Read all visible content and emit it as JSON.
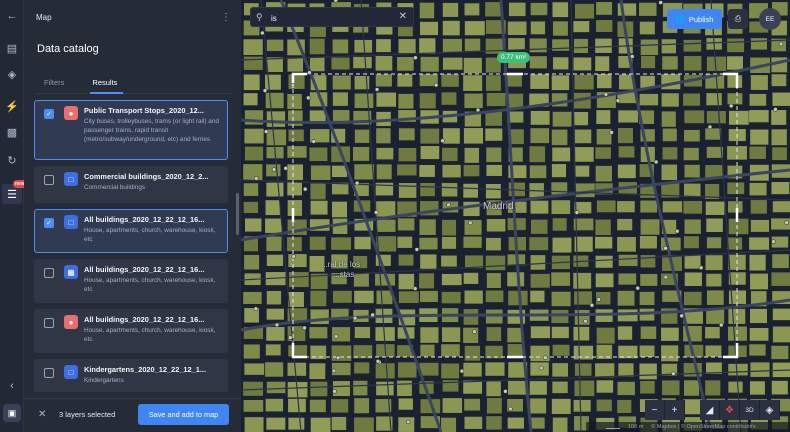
{
  "app": {
    "panel_label": "Map",
    "catalog_title": "Data catalog"
  },
  "tabs": [
    {
      "label": "Filters",
      "active": false
    },
    {
      "label": "Results",
      "active": true
    }
  ],
  "results": [
    {
      "title": "Public Transport Stops_2020_12...",
      "desc": "City buses, trolleybuses, trams (or light rail) and passenger trains, rapid transit (metro/subway/underground, etc) and ferries",
      "checked": true,
      "icon": "pin-icon"
    },
    {
      "title": "Commercial buildings_2020_12_2...",
      "desc": "Commercial buildings",
      "checked": false,
      "icon": "polygon-icon"
    },
    {
      "title": "All buildings_2020_12_22_12_16...",
      "desc": "House, apartments, church, warehouse, kiosk, etc",
      "checked": true,
      "icon": "polygon-icon"
    },
    {
      "title": "All buildings_2020_12_22_12_16...",
      "desc": "House, apartments, church, warehouse, kiosk, etc",
      "checked": false,
      "icon": "grid-icon"
    },
    {
      "title": "All buildings_2020_12_22_12_16...",
      "desc": "House, apartments, church, warehouse, kiosk, etc",
      "checked": false,
      "icon": "pin-icon"
    },
    {
      "title": "Kindergartens_2020_12_22_12_1...",
      "desc": "Kindergartens",
      "checked": false,
      "icon": "polygon-icon"
    }
  ],
  "footer": {
    "selected_count": "3 layers selected",
    "save_label": "Save and add to map"
  },
  "rail": {
    "new_badge": "new"
  },
  "search": {
    "value": "is"
  },
  "header": {
    "publish_label": "Publish",
    "avatar_initials": "EE"
  },
  "map": {
    "area_badge": "0.77 km²",
    "city_label": "Madrid",
    "place_label_1": "...ral de los",
    "place_label_2": "...stas",
    "controls": {
      "zoom_out": "−",
      "zoom_in": "+",
      "three_d": "3D"
    },
    "attribution": {
      "scale": "100 m",
      "credit": "© Mapbox | © OpenStreetMap contributors"
    }
  },
  "colors": {
    "accent": "#3f86f2",
    "area_badge": "#3cbf7a",
    "building_fill": "#7e8a4a",
    "map_background": "#1a2131"
  }
}
